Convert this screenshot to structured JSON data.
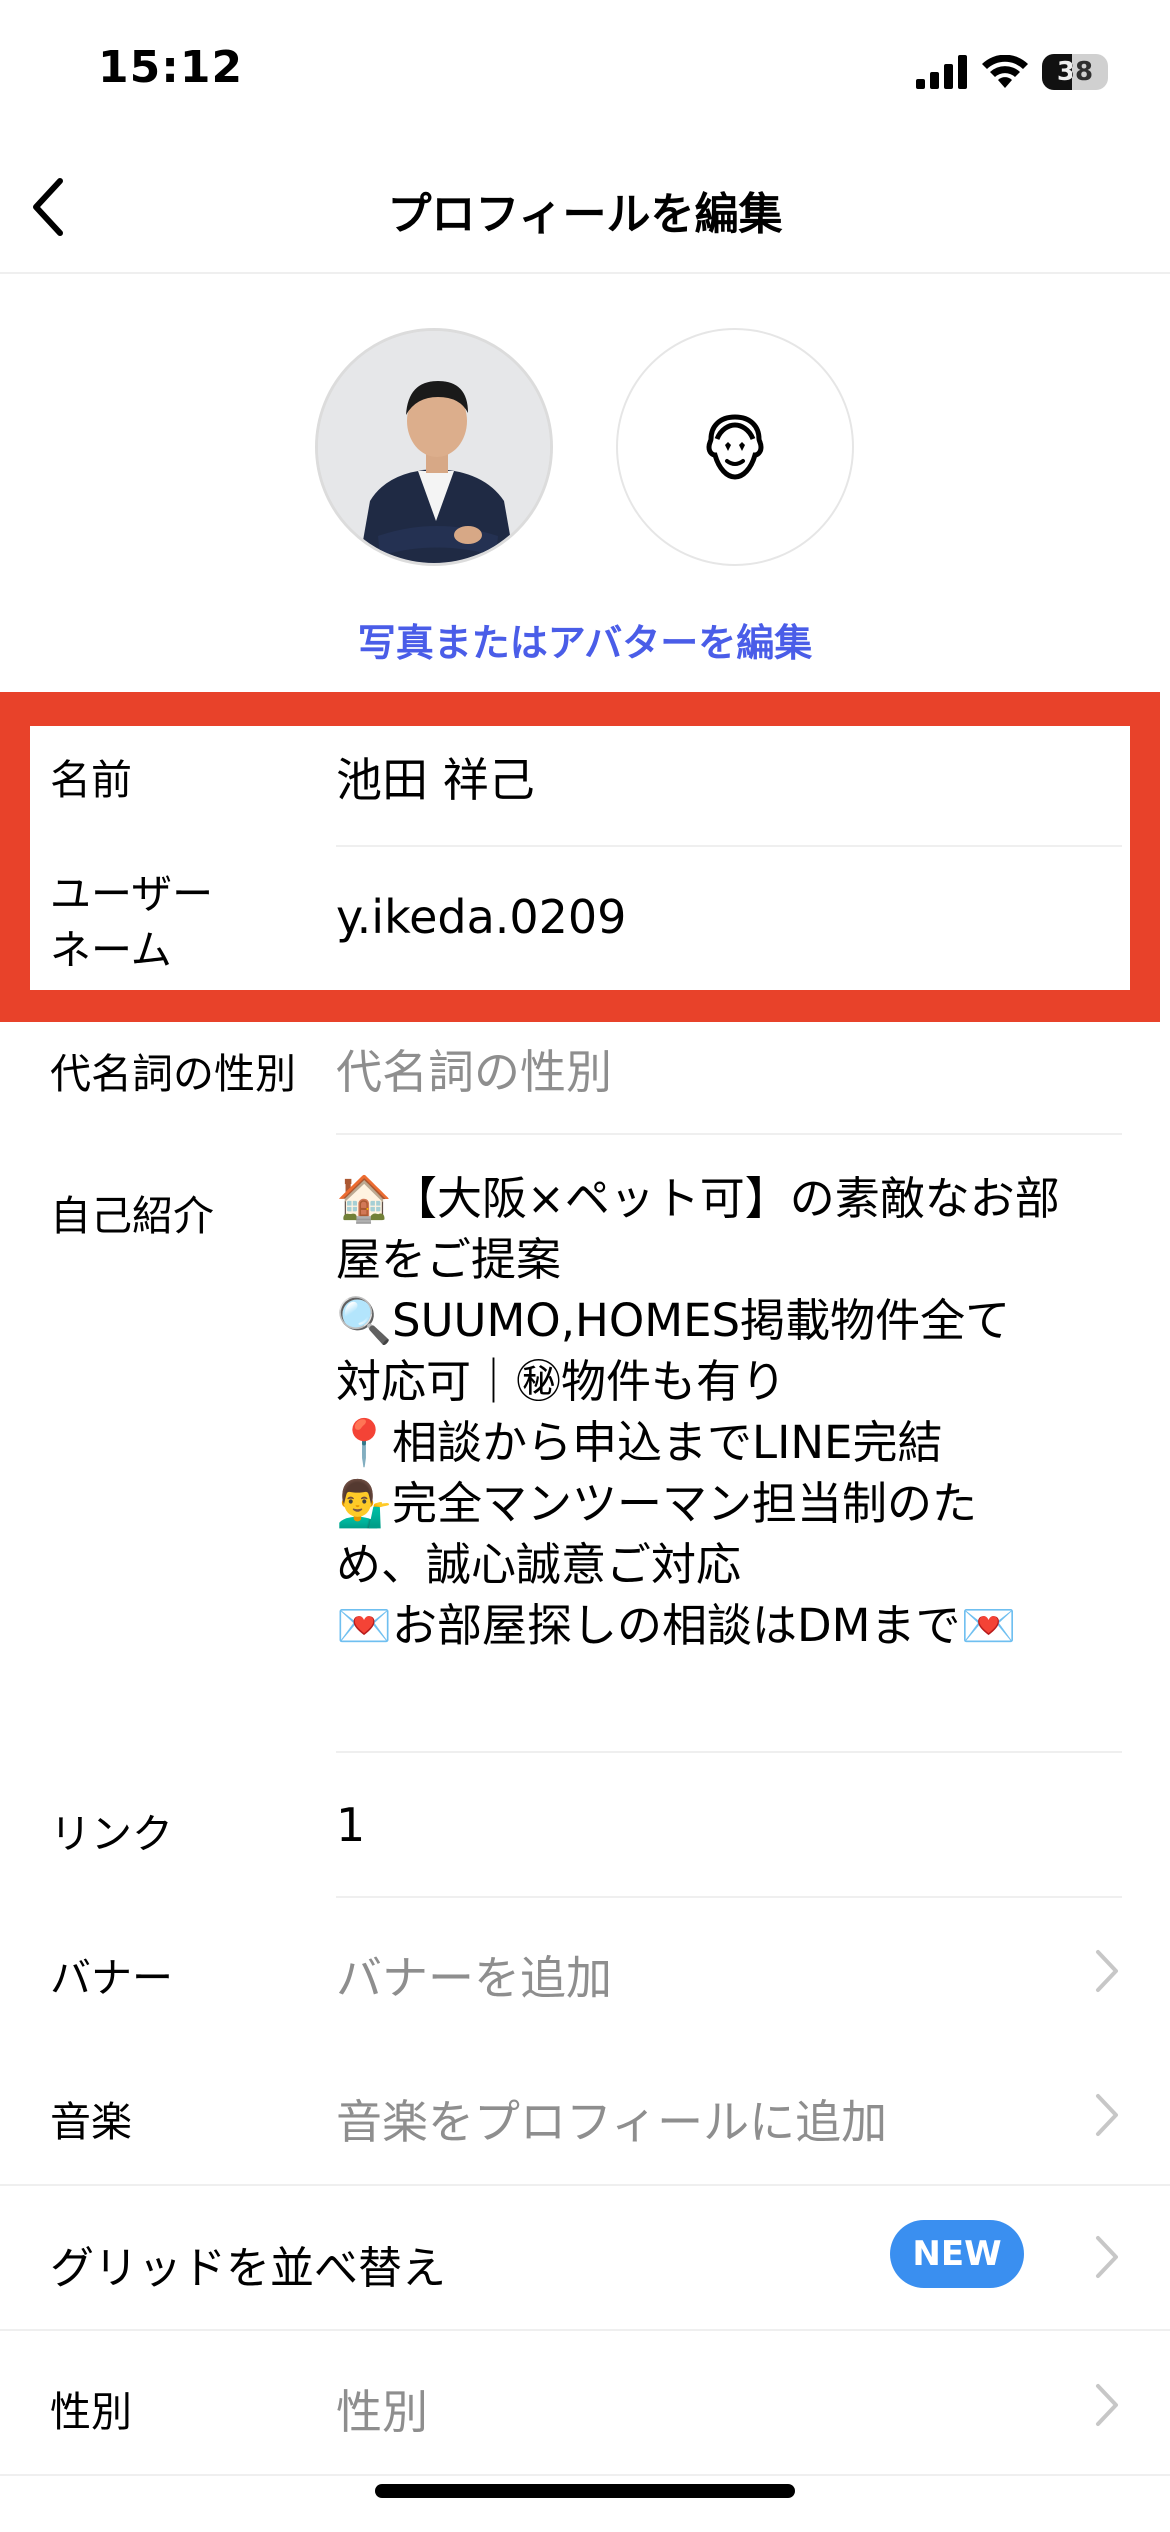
{
  "status_bar": {
    "time": "15:12",
    "battery_level": "38",
    "icons": [
      "signal-icon",
      "wifi-icon",
      "battery-icon"
    ]
  },
  "header": {
    "title": "プロフィールを編集",
    "back_icon": "chevron-left-icon"
  },
  "avatars": {
    "alt_icon": "avatar-face-icon",
    "edit_link": "写真またはアバターを編集"
  },
  "fields": {
    "name": {
      "label": "名前",
      "value": "池田 祥己"
    },
    "username": {
      "label_line1": "ユーザー",
      "label_line2": "ネーム",
      "value": "y.ikeda.0209"
    },
    "pronouns": {
      "label": "代名詞の性別",
      "placeholder": "代名詞の性別"
    },
    "bio": {
      "label": "自己紹介",
      "lines": [
        "🏠【大阪×ペット可】の素敵なお部",
        "屋をご提案",
        "🔍SUUMO,HOMES掲載物件全て",
        "対応可｜㊙物件も有り",
        "📍相談から申込までLINE完結",
        "💁‍♂️完全マンツーマン担当制のた",
        "め、誠心誠意ご対応",
        "💌お部屋探しの相談はDMまで💌"
      ]
    },
    "links": {
      "label": "リンク",
      "value": "1"
    },
    "banner": {
      "label": "バナー",
      "placeholder": "バナーを追加"
    },
    "music": {
      "label": "音楽",
      "placeholder": "音楽をプロフィールに追加"
    },
    "grid": {
      "label": "グリッドを並べ替え",
      "badge": "NEW"
    },
    "gender": {
      "label": "性別",
      "placeholder": "性別"
    }
  },
  "colors": {
    "accent_link": "#4a5de8",
    "highlight": "#e8422a",
    "badge": "#3a8ff0",
    "placeholder": "#8e8e8e"
  }
}
